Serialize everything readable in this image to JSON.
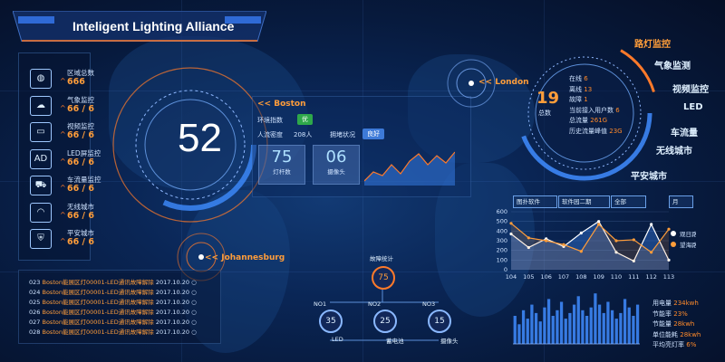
{
  "title": "Inteligent Lighting Alliance",
  "colors": {
    "accent": "#ff9d3a",
    "primary": "#3f8cff",
    "background": "#06122e",
    "green": "#2ea84a",
    "blue": "#3d7ad8"
  },
  "categories": [
    {
      "icon": "globe-icon",
      "label": "区域总数",
      "value": "666"
    },
    {
      "icon": "weather-icon",
      "label": "气象监控",
      "value": "66",
      "total": "6"
    },
    {
      "icon": "camera-icon",
      "label": "视频监控",
      "value": "66",
      "total": "6"
    },
    {
      "icon": "led-icon",
      "label": "LED屏监控",
      "value": "66",
      "total": "6"
    },
    {
      "icon": "car-icon",
      "label": "车流量监控",
      "value": "66",
      "total": "6"
    },
    {
      "icon": "wireless-icon",
      "label": "无线城市",
      "value": "66",
      "total": "6"
    },
    {
      "icon": "shield-icon",
      "label": "平安城市",
      "value": "66",
      "total": "6"
    }
  ],
  "big_number": "52",
  "info": {
    "city": "<< Boston",
    "env_label": "环境指数",
    "env_badge": "优",
    "people_label": "人流密度",
    "people_value": "208人",
    "traffic_label": "拥堵状况",
    "traffic_badge": "良好",
    "stat1_value": "75",
    "stat1_label": "灯杆数",
    "stat2_value": "06",
    "stat2_label": "摄像头"
  },
  "cities": {
    "london": "<< London",
    "johannesburg": "<< Johannesburg"
  },
  "right_ring": {
    "number": "19",
    "number_label": "总数",
    "rows": [
      {
        "k": "在线",
        "v": "6"
      },
      {
        "k": "离线",
        "v": "13"
      },
      {
        "k": "故障",
        "v": "1"
      },
      {
        "k": "当前接入用户数",
        "v": "6"
      },
      {
        "k": "总流量",
        "v": "261G"
      },
      {
        "k": "历史流量峰值",
        "v": "23G"
      }
    ]
  },
  "right_menu": [
    "路灯监控",
    "气象监测",
    "视频监控",
    "LED",
    "车流量",
    "无线城市",
    "平安城市"
  ],
  "filters": [
    "图扑软件",
    "软件园二期",
    "全部",
    "月"
  ],
  "chart_data": [
    {
      "type": "line",
      "x": [
        "104",
        "105",
        "106",
        "107",
        "108",
        "109",
        "110",
        "111",
        "112",
        "113"
      ],
      "ylim": [
        0,
        600
      ],
      "yticks": [
        "0",
        "100",
        "200",
        "300",
        "400",
        "500",
        "600"
      ],
      "legend_position": "right",
      "series": [
        {
          "name": "观日路",
          "color": "#ffffff",
          "values": [
            370,
            230,
            320,
            240,
            380,
            500,
            180,
            90,
            470,
            100
          ]
        },
        {
          "name": "望海路",
          "color": "#ff9d3a",
          "values": [
            480,
            330,
            300,
            260,
            190,
            470,
            300,
            310,
            180,
            420
          ]
        }
      ]
    },
    {
      "type": "bar",
      "values": [
        50,
        35,
        60,
        45,
        70,
        55,
        40,
        65,
        80,
        50,
        60,
        75,
        45,
        55,
        70,
        85,
        60,
        50,
        65,
        90,
        70,
        55,
        75,
        60,
        45,
        55,
        80,
        65,
        50,
        70
      ],
      "ylim": [
        0,
        100
      ]
    }
  ],
  "energy": [
    {
      "k": "用电量",
      "v": "234kwh"
    },
    {
      "k": "节能率",
      "v": "23%"
    },
    {
      "k": "节能量",
      "v": "28kwh"
    },
    {
      "k": "单位能耗",
      "v": "28kwh"
    },
    {
      "k": "平均亮灯率",
      "v": "6%"
    }
  ],
  "logs": [
    {
      "id": "023",
      "msg": "Boston能展区灯00001-LED通讯故障解除",
      "date": "2017.10.20"
    },
    {
      "id": "024",
      "msg": "Boston能展区灯00001-LED通讯故障解除",
      "date": "2017.10.20"
    },
    {
      "id": "025",
      "msg": "Boston能展区灯00001-LED通讯故障解除",
      "date": "2017.10.20"
    },
    {
      "id": "026",
      "msg": "Boston能展区灯00001-LED通讯故障解除",
      "date": "2017.10.20"
    },
    {
      "id": "027",
      "msg": "Boston能展区灯00001-LED通讯故障解除",
      "date": "2017.10.20"
    },
    {
      "id": "028",
      "msg": "Boston能展区灯00001-LED通讯故障解除",
      "date": "2017.10.20"
    }
  ],
  "fault": {
    "label": "故障统计",
    "total": "75",
    "nodes": [
      {
        "name": "NO1",
        "value": "35",
        "sub": "LED"
      },
      {
        "name": "NO2",
        "value": "25",
        "sub": "蓄电池"
      },
      {
        "name": "NO3",
        "value": "15",
        "sub": "摄像头"
      }
    ]
  }
}
